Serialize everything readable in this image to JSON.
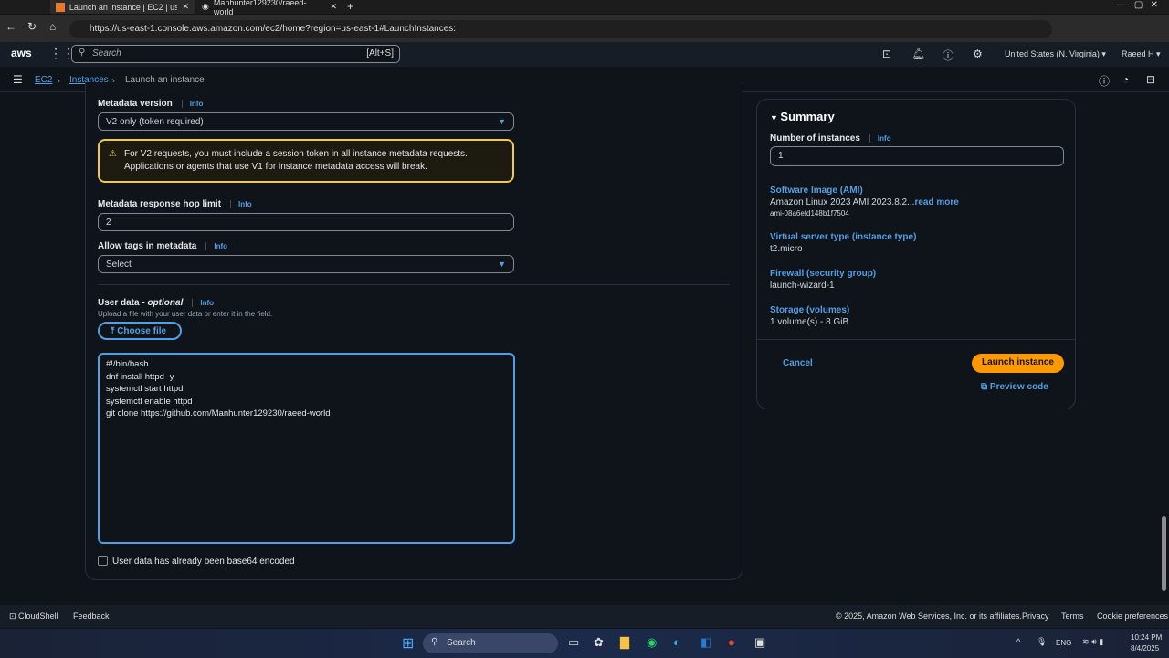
{
  "browser": {
    "tabs": [
      {
        "title": "Launch an instance | EC2 | us-east"
      },
      {
        "title": "Manhunter129230/raeed-world"
      }
    ],
    "url": "https://us-east-1.console.aws.amazon.com/ec2/home?region=us-east-1#LaunchInstances:"
  },
  "aws_nav": {
    "logo": "aws",
    "search_placeholder": "Search",
    "search_shortcut": "[Alt+S]",
    "region": "United States (N. Virginia) ▾",
    "user": "Raeed H ▾"
  },
  "breadcrumb": [
    "EC2",
    "Instances",
    "Launch an instance"
  ],
  "form": {
    "metadata_version": {
      "label": "Metadata version",
      "info": "Info",
      "value": "V2 only (token required)"
    },
    "warning": {
      "line1": "For V2 requests, you must include a session token in all instance metadata requests.",
      "line2": "Applications or agents that use V1 for instance metadata access will break."
    },
    "hop_limit": {
      "label": "Metadata response hop limit",
      "info": "Info",
      "value": "2"
    },
    "allow_tags": {
      "label": "Allow tags in metadata",
      "info": "Info",
      "value": "Select"
    },
    "user_data": {
      "label": "User data - ",
      "label_optional": "optional",
      "info": "Info",
      "description": "Upload a file with your user data or enter it in the field.",
      "choose_file": "Choose file",
      "content": "#!/bin/bash\ndnf install httpd -y\nsystemctl start httpd\nsystemctl enable httpd\ngit clone https://github.com/Manhunter129230/raeed-world",
      "base64_label": "User data has already been base64 encoded"
    }
  },
  "summary": {
    "title": "Summary",
    "num_label": "Number of instances",
    "info": "Info",
    "num_value": "1",
    "ami_label": "Software Image (AMI)",
    "ami_value": "Amazon Linux 2023 AMI 2023.8.2...",
    "read_more": "read more",
    "ami_id": "ami-08a6efd148b1f7504",
    "type_label": "Virtual server type (instance type)",
    "type_value": "t2.micro",
    "fw_label": "Firewall (security group)",
    "fw_value": "launch-wizard-1",
    "storage_label": "Storage (volumes)",
    "storage_value": "1 volume(s) - 8 GiB",
    "cancel": "Cancel",
    "launch": "Launch instance",
    "preview": "Preview code"
  },
  "footer": {
    "cloudshell": "CloudShell",
    "feedback": "Feedback",
    "copyright": "© 2025, Amazon Web Services, Inc. or its affiliates.",
    "privacy": "Privacy",
    "terms": "Terms",
    "cookies": "Cookie preferences"
  },
  "taskbar": {
    "search": "Search",
    "lang": "ENG",
    "time": "10:24 PM",
    "date": "8/4/2025"
  },
  "colors": {
    "accent": "#539fe5",
    "primary_button": "#ff9900",
    "warning_border": "#f2c94c"
  }
}
